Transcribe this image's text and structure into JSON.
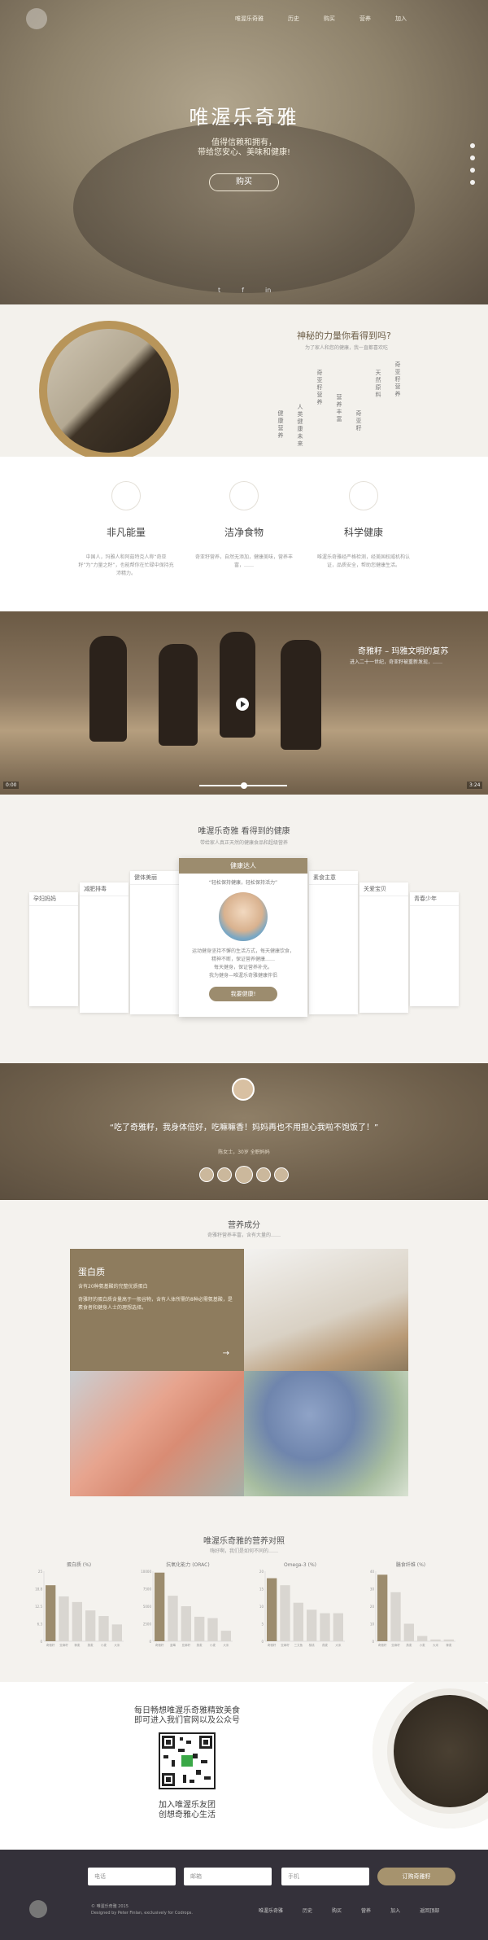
{
  "hero": {
    "nav": [
      "唯渥乐奇雅",
      "历史",
      "购买",
      "营养",
      "加入"
    ],
    "title": "唯渥乐奇雅",
    "subtitle1": "值得信赖和拥有，",
    "subtitle2": "带给您安心、美味和健康!",
    "buy": "购买",
    "social": [
      "t",
      "f",
      "in"
    ]
  },
  "power": {
    "title": "神秘的力量你看得到吗?",
    "sub": "为了家人和您的健康，我一直都喜欢吃",
    "vcols": [
      "健康营养",
      "人类健康未来",
      "奇亚籽营养",
      "营养丰富",
      "奇亚籽",
      "天然原料",
      "奇亚籽营养"
    ]
  },
  "features": [
    {
      "title": "非凡能量",
      "text": "中国人，玛雅人和阿兹特克人称“奇亚籽”为“力量之籽”，也能帮你在忙碌中保持充沛精力。"
    },
    {
      "title": "洁净食物",
      "text": "奇亚籽营养，自然无添加，健康美味，营养丰富，……"
    },
    {
      "title": "科学健康",
      "text": "唯渥乐奇雅经严格检测，经美国权威机构认证，品质安全，帮助您健康生活。"
    }
  ],
  "video": {
    "title": "奇雅籽 – 玛雅文明的复苏",
    "sub": "进入二十一世纪，奇亚籽被重新发现，……",
    "t1": "0:00",
    "t2": "3:24"
  },
  "cards": {
    "title": "唯渥乐奇雅 看得到的健康",
    "sub": "带给家人真正天然的健康食品和超级营养",
    "tabs": [
      "孕妇妈妈",
      "减肥排毒",
      "健体美丽",
      "健康达人",
      "素食主意",
      "关爱宝贝",
      "青春少年"
    ],
    "center": {
      "quote": "“轻松保持健康，轻松保持活力”",
      "lines": [
        "运动健身坚持不懈的生活方式，每天健康饮食，",
        "精神不断，保证营养健康……",
        "每天健身，保证营养补充。",
        "我为健身—唯渥乐奇雅健康伴侣"
      ],
      "button": "我要健康!"
    }
  },
  "testimonial": {
    "quote": "“吃了奇雅籽，我身体倍好，吃嘛嘛香！妈妈再也不用担心我啦不饱饭了！”",
    "by": "陈女士，30岁 全职妈妈"
  },
  "nutrition": {
    "title": "营养成分",
    "sub": "奇雅籽营养丰富，含有大量的……",
    "protein": {
      "title": "蛋白质",
      "line1": "含有20种氨基酸的完整优质蛋白",
      "line2": "奇雅籽的蛋白质含量高于一般谷物，含有人体所需的8种必需氨基酸，是素食者和健身人士的理想选择。"
    }
  },
  "chart_data": [
    {
      "type": "bar",
      "title": "蛋白质 (%)",
      "categories": [
        "奇雅籽",
        "亚麻籽",
        "藜麦",
        "燕麦",
        "小麦",
        "大米"
      ],
      "values": [
        20,
        16,
        14,
        11,
        9,
        6
      ],
      "ylim": [
        0,
        25
      ]
    },
    {
      "type": "bar",
      "title": "抗氧化能力 (ORAC)",
      "categories": [
        "奇雅籽",
        "蓝莓",
        "亚麻籽",
        "燕麦",
        "小麦",
        "大米"
      ],
      "values": [
        9800,
        6500,
        5000,
        3500,
        3300,
        1500
      ],
      "ylim": [
        0,
        10000
      ]
    },
    {
      "type": "bar",
      "title": "Omega-3 (%)",
      "categories": [
        "奇雅籽",
        "亚麻籽",
        "三文鱼",
        "核桃",
        "燕麦",
        "大米"
      ],
      "values": [
        18,
        16,
        11,
        9,
        8,
        8
      ],
      "ylim": [
        0,
        20
      ]
    },
    {
      "type": "bar",
      "title": "膳食纤维 (%)",
      "categories": [
        "奇雅籽",
        "亚麻籽",
        "燕麦",
        "小麦",
        "大米",
        "藜麦"
      ],
      "values": [
        38,
        28,
        10,
        3,
        1,
        1
      ],
      "ylim": [
        0,
        40
      ]
    }
  ],
  "charts": {
    "title": "唯渥乐奇雅的营养对照",
    "sub": "嗨好啊，我们是如何不同的……"
  },
  "qr": {
    "top1": "每日畅想唯渥乐奇雅精致美食",
    "top2": "即可进入我们官网以及公众号",
    "bottom1": "加入唯渥乐友团",
    "bottom2": "创想奇雅心生活"
  },
  "footer": {
    "placeholders": [
      "电话",
      "邮箱",
      "手机"
    ],
    "button": "订购奇雅籽",
    "copy1": "© 唯渥乐奇雅 2015",
    "copy2": "Designed by Peter Finlan, exclusively for Codrops.",
    "nav": [
      "唯渥乐奇雅",
      "历史",
      "购买",
      "营养",
      "加入",
      "返回顶部"
    ]
  }
}
